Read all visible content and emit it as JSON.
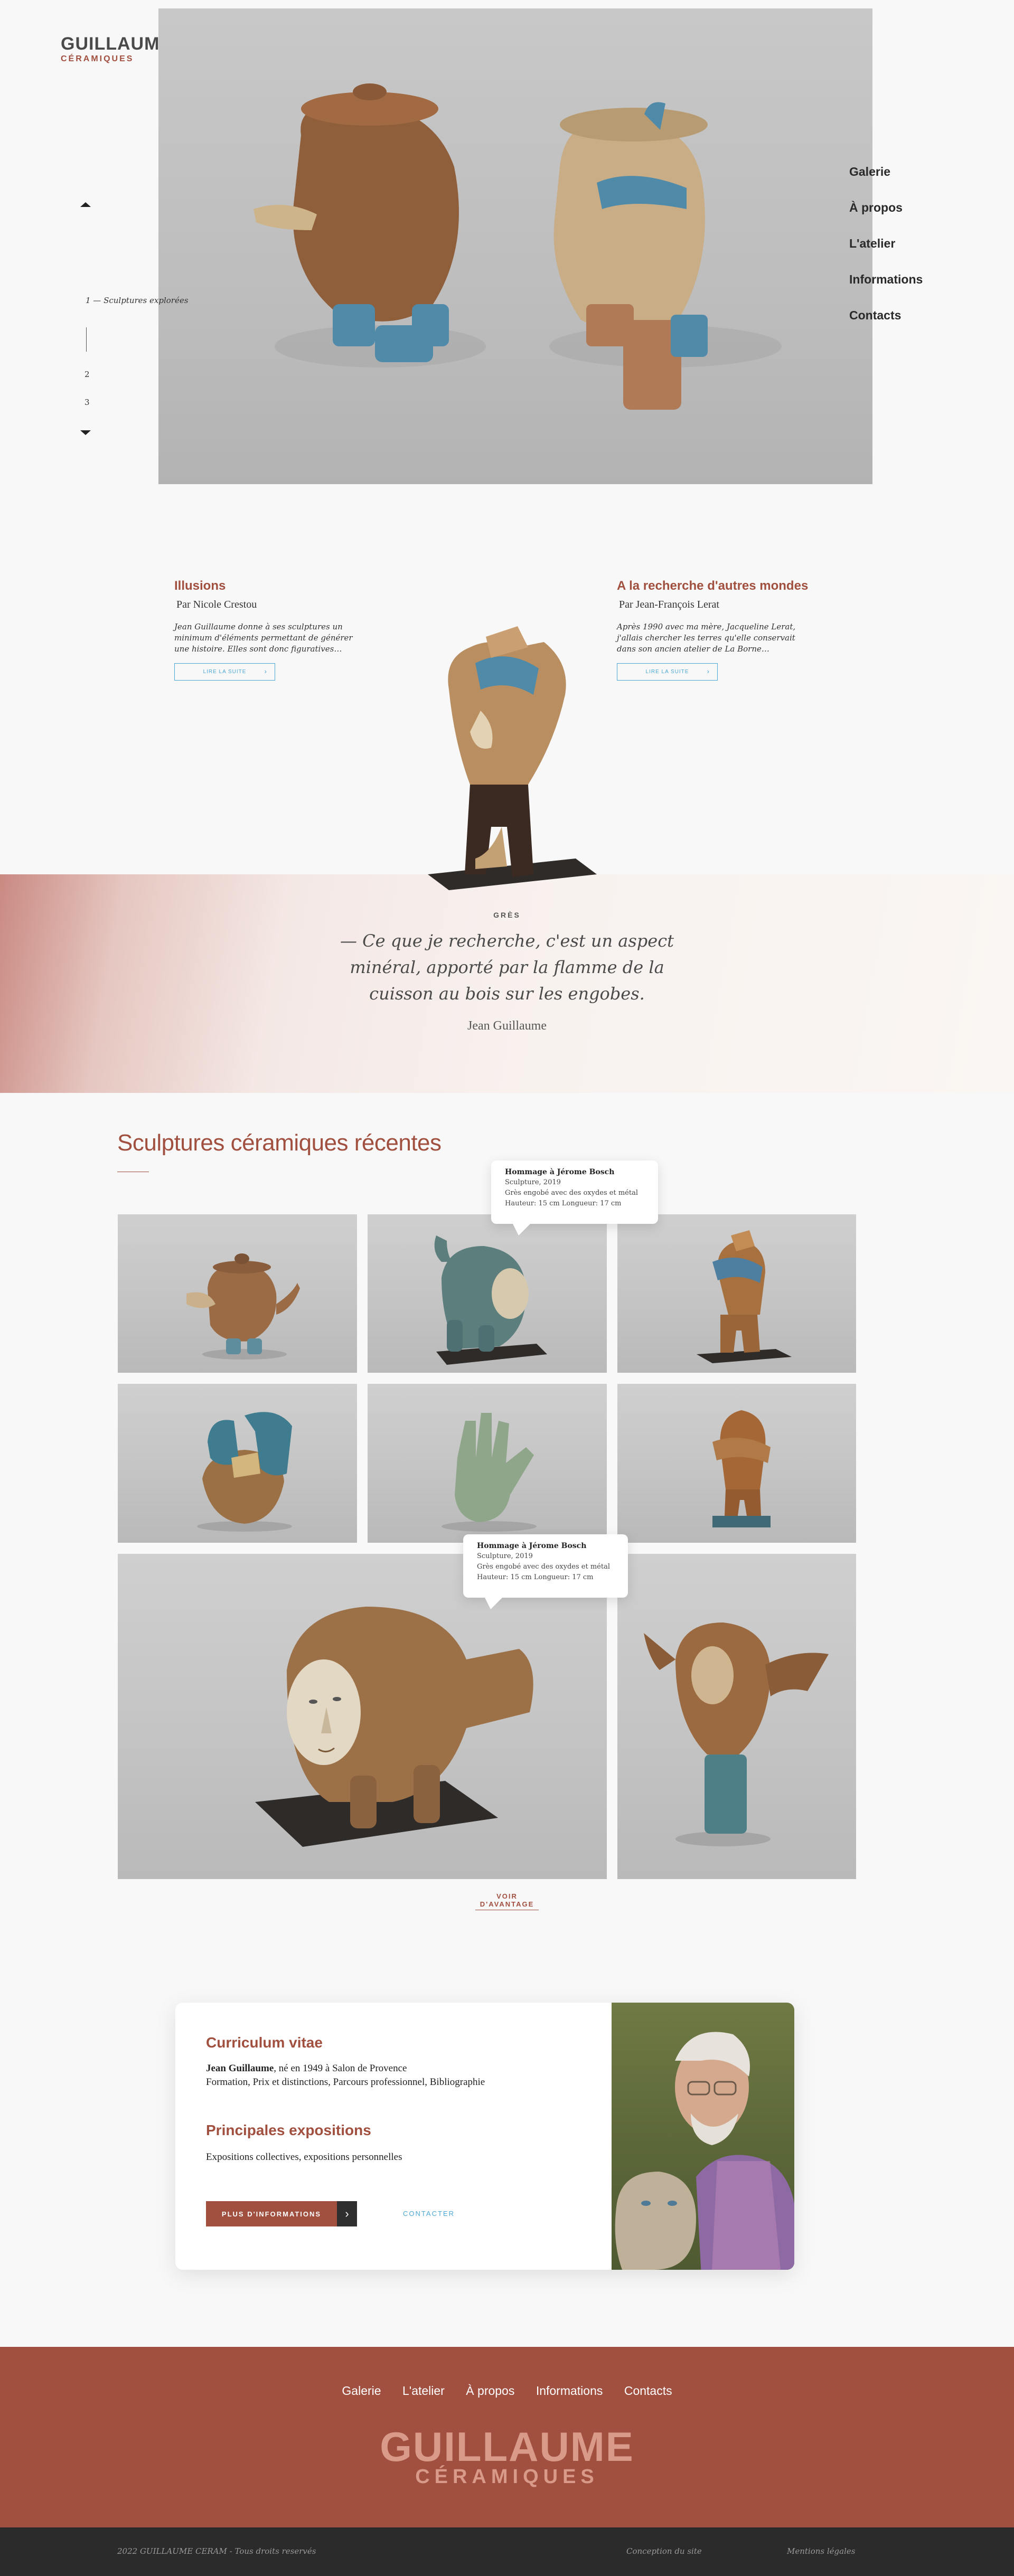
{
  "header": {
    "logo_main": "GUILLAUME",
    "logo_sub": "CÉRAMIQUES",
    "nav": [
      "Galerie",
      "À propos",
      "L'atelier",
      "Informations",
      "Contacts"
    ]
  },
  "hero": {
    "slide_label": "1 — Sculptures explorées",
    "slide_numbers": [
      "2",
      "3"
    ],
    "up_icon": "triangle-up",
    "down_icon": "triangle-down"
  },
  "articles": [
    {
      "title": "Illusions",
      "author": "Par Nicole Crestou",
      "text": "Jean Guillaume donne à ses sculptures un minimum d'éléments permettant de générer une histoire. Elles sont donc figuratives…",
      "button": "LIRE LA SUITE"
    },
    {
      "title": "A la recherche d'autres mondes",
      "author": "Par Jean-François Lerat",
      "text": "Après 1990 avec ma mère, Jacqueline Lerat, j'allais chercher les terres qu'elle conservait dans son ancien atelier de La Borne…",
      "button": "LIRE LA SUITE"
    }
  ],
  "quote": {
    "kicker": "GRÈS",
    "text": "— Ce que je recherche, c'est un aspect minéral, apporté par la flamme de la cuisson au bois sur les engobes.",
    "author": "Jean Guillaume"
  },
  "gallery": {
    "title": "Sculptures céramiques récentes",
    "tooltip": {
      "title": "Hommage à Jérome Bosch",
      "line1": "Sculpture, 2019",
      "line2": "Grès engobé avec des oxydes et métal",
      "line3": "Hauteur: 15 cm Longueur: 17 cm"
    },
    "more": "VOIR D'AVANTAGE"
  },
  "cv": {
    "title1": "Curriculum vitae",
    "name": "Jean Guillaume",
    "line1_rest": ", né en 1949 à Salon de Provence",
    "line2": "Formation, Prix et distinctions, Parcours professionnel, Bibliographie",
    "title2": "Principales expositions",
    "line3": "Expositions collectives, expositions personnelles",
    "button": "PLUS D'INFORMATIONS",
    "contact": "CONTACTER"
  },
  "footer": {
    "nav": [
      "Galerie",
      "L'atelier",
      "À propos",
      "Informations",
      "Contacts"
    ],
    "logo_main": "GUILLAUME",
    "logo_sub": "CÉRAMIQUES",
    "copyright": "2022 GUILLAUME CERAM - Tous droits reservés",
    "credit": "Conception du site",
    "legal": "Mentions légales"
  },
  "colors": {
    "accent": "#a14f3f",
    "link": "#4ba8d6",
    "dark": "#2b2b2b"
  }
}
